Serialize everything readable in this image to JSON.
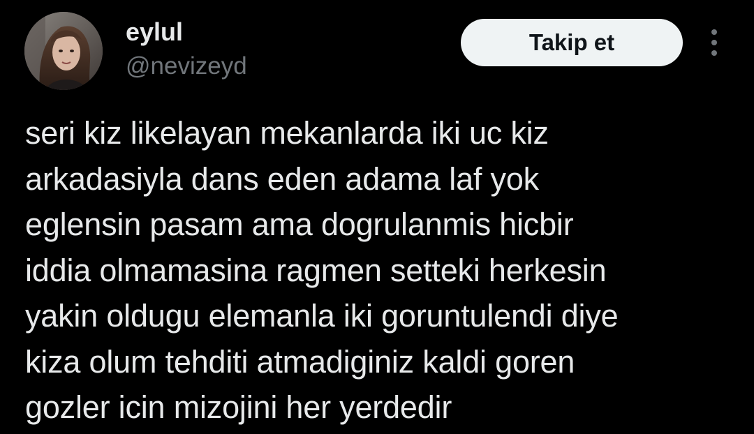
{
  "author": {
    "display_name": "eylul",
    "handle": "@nevizeyd"
  },
  "actions": {
    "follow_label": "Takip et",
    "more_icon": "more-vertical-icon"
  },
  "tweet": {
    "text": "seri kiz likelayan mekanlarda iki uc kiz\narkadasiyla dans eden adama laf yok\neglensin pasam ama dogrulanmis hicbir\niddia olmamasina ragmen setteki herkesin\nyakin oldugu elemanla iki goruntulendi diye\nkiza olum tehditi atmadiginiz kaldi goren\ngozler icin mizojini her yerdedir"
  },
  "colors": {
    "background": "#000000",
    "primary_text": "#e7e9ea",
    "secondary_text": "#71767b",
    "button_bg": "#eff3f4",
    "button_text": "#0f1419"
  }
}
